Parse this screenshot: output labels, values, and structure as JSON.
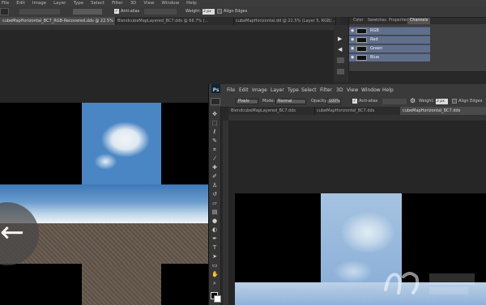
{
  "back_window": {
    "menu": [
      "File",
      "Edit",
      "Image",
      "Layer",
      "Type",
      "Select",
      "Filter",
      "3D",
      "View",
      "Window",
      "Help"
    ],
    "options": {
      "anti_alias_label": "Anti-alias",
      "weight_label": "Weight:",
      "weight_value": "2 px",
      "align_edges_label": "Align Edges"
    },
    "tabs": [
      "cubeMapHorizontal_BC7_RGB-Recovered.dds @ 22.5% (RGB/8) *",
      "BlendcubeMapLayered_BC7.dds @ 66.7% (...",
      "cubeMapHorizontal.dd @ 22.5% (Layer 5, RGB/..."
    ],
    "panel": {
      "tabs": [
        "Color",
        "Swatches",
        "Properties",
        "Channels"
      ],
      "active_tab": "Channels",
      "channels": [
        "RGB",
        "Red",
        "Green",
        "Blue"
      ]
    }
  },
  "front_window": {
    "logo": "Ps",
    "menu": [
      "File",
      "Edit",
      "Image",
      "Layer",
      "Type",
      "Select",
      "Filter",
      "3D",
      "View",
      "Window",
      "Help"
    ],
    "options": {
      "feather_value": "Pixels",
      "mode_label": "Mode:",
      "mode_value": "Normal",
      "opacity_label": "Opacity:",
      "opacity_value": "100%",
      "anti_alias_label": "Anti-alias",
      "weight_label": "Weight:",
      "weight_value": "2 px",
      "align_edges_label": "Align Edges"
    },
    "tabs": [
      "BlendcubeMapLayered_BC7.dds",
      "cubeMapHorizontal_BC7.dds",
      "cubeMapHorizontal_BC7.dds"
    ]
  },
  "colors": {
    "sky_top": "#3e78b8",
    "channel_selected": "#5f6f8c",
    "panel_bg": "#3e3e3e"
  },
  "icons": [
    "move-icon",
    "marquee-icon",
    "lasso-icon",
    "quick-select-icon",
    "crop-icon",
    "eyedropper-icon",
    "healing-icon",
    "brush-icon",
    "stamp-icon",
    "history-brush-icon",
    "eraser-icon",
    "gradient-icon",
    "blur-icon",
    "dodge-icon",
    "pen-icon",
    "type-icon",
    "path-select-icon",
    "shape-icon",
    "hand-icon",
    "zoom-icon",
    "back-arrow-icon"
  ]
}
